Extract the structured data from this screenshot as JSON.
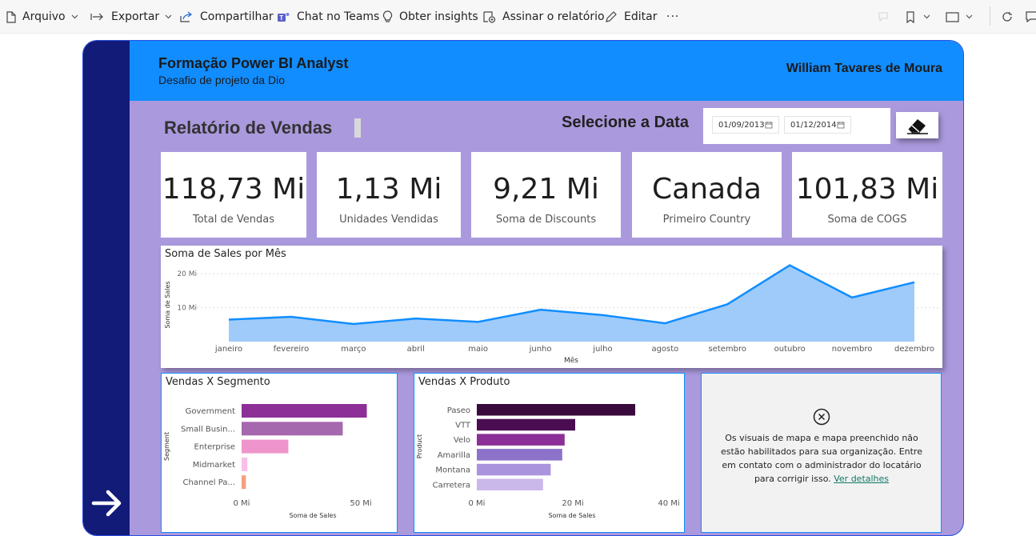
{
  "toolbar": {
    "file": "Arquivo",
    "export": "Exportar",
    "share": "Compartilhar",
    "teams": "Chat no Teams",
    "insights": "Obter insights",
    "subscribe": "Assinar o relatório",
    "edit": "Editar",
    "more": "···"
  },
  "header": {
    "title": "Formação Power BI Analyst",
    "subtitle": "Desafio de projeto da Dio",
    "author": "William Tavares de Moura"
  },
  "page": {
    "title": "Relatório de Vendas",
    "date_label": "Selecione a Data",
    "date_start": "01/09/2013",
    "date_end": "01/12/2014"
  },
  "kpis": [
    {
      "value": "118,73 Mi",
      "label": "Total de Vendas"
    },
    {
      "value": "1,13 Mi",
      "label": "Unidades Vendidas"
    },
    {
      "value": "9,21 Mi",
      "label": "Soma de Discounts"
    },
    {
      "value": "Canada",
      "label": "Primeiro Country"
    },
    {
      "value": "101,83 Mi",
      "label": "Soma de COGS"
    }
  ],
  "colors": {
    "accent": "#118dff",
    "sidebar": "#121b78",
    "canvas": "#ab99dd",
    "area_line": "#118dff",
    "area_fill": "#9fcbfa"
  },
  "chart_data": [
    {
      "type": "area",
      "title": "Soma de Sales por Mês",
      "xlabel": "Mês",
      "ylabel": "Soma de Sales",
      "categories": [
        "janeiro",
        "fevereiro",
        "março",
        "abril",
        "maio",
        "junho",
        "julho",
        "agosto",
        "setembro",
        "outubro",
        "novembro",
        "dezembro"
      ],
      "values": [
        6.5,
        7.3,
        5.2,
        6.8,
        5.8,
        9.4,
        7.8,
        5.4,
        11,
        22.5,
        13,
        17.5
      ],
      "yticks": [
        "10 Mi",
        "20 Mi"
      ],
      "ytick_values": [
        10,
        20
      ],
      "ylim": [
        0,
        25
      ],
      "grid": true
    },
    {
      "type": "bar",
      "title": "Vendas X Segmento",
      "xlabel": "Soma de Sales",
      "ylabel": "Segment",
      "categories": [
        "Government",
        "Small Busin...",
        "Enterprise",
        "Midmarket",
        "Channel Pa..."
      ],
      "values": [
        52.5,
        42.4,
        19.6,
        2.4,
        1.8
      ],
      "colors": [
        "#8c2f96",
        "#a567ad",
        "#ef94cc",
        "#f9bfe8",
        "#f4a07e"
      ],
      "xticks": [
        "0 Mi",
        "50 Mi"
      ],
      "xtick_values": [
        0,
        50
      ],
      "xlim": [
        0,
        53
      ]
    },
    {
      "type": "bar",
      "title": "Vendas X Produto",
      "xlabel": "Soma de Sales",
      "ylabel": "Product",
      "categories": [
        "Paseo",
        "VTT",
        "Velo",
        "Amarilla",
        "Montana",
        "Carretera"
      ],
      "values": [
        33,
        20.5,
        18.3,
        17.8,
        15.4,
        13.8
      ],
      "colors": [
        "#3a0a3d",
        "#4b0c52",
        "#8c2f96",
        "#8c72c8",
        "#ab94de",
        "#cbb8ea"
      ],
      "xticks": [
        "0 Mi",
        "20 Mi",
        "40 Mi"
      ],
      "xtick_values": [
        0,
        20,
        40
      ],
      "xlim": [
        0,
        42
      ]
    }
  ],
  "map": {
    "message": "Os visuais de mapa e mapa preenchido não estão habilitados para sua organização. Entre em contato com o administrador do locatário para corrigir isso.",
    "link": "Ver detalhes"
  }
}
